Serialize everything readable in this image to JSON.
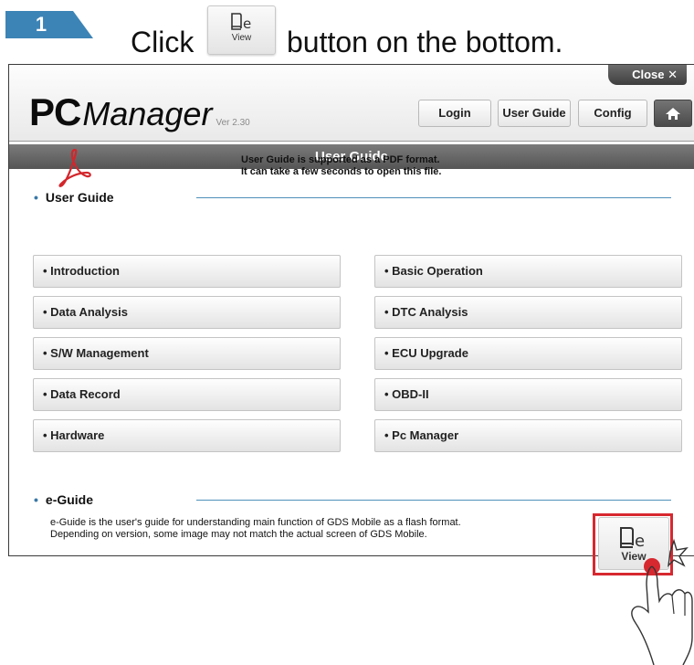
{
  "instruction": {
    "step_number": "1",
    "click_text": "Click",
    "rest_text": "button on the bottom.",
    "mini_view_label": "View"
  },
  "app": {
    "logo_pc": "PC",
    "logo_manager": "Manager",
    "version": "Ver 2.30",
    "close_label": "Close ✕",
    "header_buttons": {
      "login": "Login",
      "user_guide": "User Guide",
      "config": "Config"
    },
    "title_bar": "User Guide"
  },
  "user_guide": {
    "heading": "User Guide",
    "note_line1": "User Guide is supported as a PDF format.",
    "note_line2": "It can take a few seconds to open this file.",
    "items_left": [
      "• Introduction",
      "• Data Analysis",
      "• S/W Management",
      "• Data Record",
      "• Hardware"
    ],
    "items_right": [
      "• Basic Operation",
      "• DTC Analysis",
      "• ECU Upgrade",
      "• OBD-II",
      "• Pc Manager"
    ]
  },
  "eguide": {
    "heading": "e-Guide",
    "desc_line1": "e-Guide is the user's guide for understanding main function of GDS Mobile as a flash format.",
    "desc_line2": "Depending on version, some image may not match the actual screen of GDS Mobile.",
    "view_label": "View"
  },
  "colors": {
    "accent_blue": "#4f90ba",
    "step_badge": "#3d84b6",
    "highlight_red": "#d7282f",
    "title_bar": "#5f5f5f"
  }
}
